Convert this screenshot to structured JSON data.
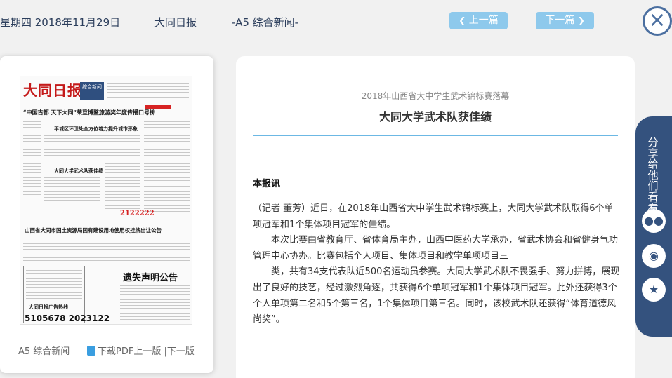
{
  "header": {
    "date": "星期四 2018年11月29日",
    "paper_name": "大同日报",
    "section": "-A5 综合新闻-",
    "prev_label": "上一篇",
    "next_label": "下一篇",
    "prev_icon": "chevron-left-icon",
    "next_icon": "chevron-right-icon",
    "close_icon": "close-icon"
  },
  "paper": {
    "thumb": {
      "masthead": "大同日报",
      "badge": "综合新闻",
      "headline_top": "“中国古都 天下大同”荣登博鳌旅游奖年度传播口号榜",
      "headline_mid": "平城区环卫处全方位着力提升城市形象",
      "headline_article": "大同大学武术队获佳绩",
      "headline_notice": "山西省大同市国土资源局国有建设用地使用权挂牌出让公告",
      "notice_small": "遗失声明公告",
      "ad_hotline": "大同日报广告热线",
      "phone": "5105678  2023122",
      "lottery": "2122222"
    },
    "footer": {
      "section": "A5 综合新闻",
      "pdf_icon": "pdf-icon",
      "download": "下载PDF",
      "prev": "上一版",
      "next": "下一版"
    }
  },
  "article": {
    "subtitle": "2018年山西省大中学生武术锦标赛落幕",
    "title": "大同大学武术队获佳绩",
    "byline_bold": "本报讯",
    "paragraphs": [
      "（记者 董芳）近日，在2018年山西省大中学生武术锦标赛上，大同大学武术队取得6个单项冠军和1个集体项目冠军的佳绩。",
      "本次比赛由省教育厅、省体育局主办，山西中医药大学承办，省武术协会和省健身气功管理中心协办。比赛包括个人项目、集体项目和教学单项项目三",
      "类，共有34支代表队近500名运动员参赛。大同大学武术队不畏强手、努力拼搏，展现出了良好的技艺，经过激烈角逐，共获得6个单项冠军和1个集体项目冠军。此外还获得3个个人单项第二名和5个第三名，1个集体项目第三名。同时，该校武术队还获得“体育道德风尚奖”。"
    ]
  },
  "share": {
    "label": "分享给他们看看",
    "icons": [
      "wechat-icon",
      "weibo-icon",
      "favorite-star-icon"
    ]
  },
  "colors": {
    "accent_blue": "#8ec9ec",
    "sidebar_navy": "#34527e",
    "rule_blue": "#6cb8e4",
    "masthead_red": "#c41a1a"
  }
}
